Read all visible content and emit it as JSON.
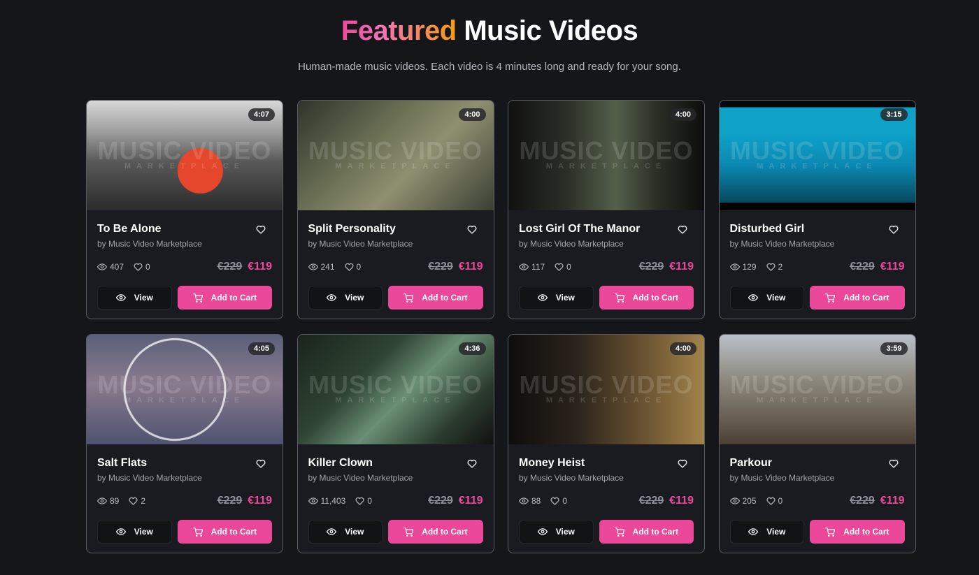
{
  "header": {
    "title_accent": "Featured",
    "title_rest": "Music Videos",
    "subtitle": "Human-made music videos. Each video is 4 minutes long and ready for your song."
  },
  "watermark": {
    "main": "MUSIC VIDEO",
    "sub": "MARKETPLACE"
  },
  "labels": {
    "view": "View",
    "add_to_cart": "Add to Cart"
  },
  "colors": {
    "background": "#15161a",
    "accent": "#ec4899",
    "card_border": "#5a5c66"
  },
  "icons": {
    "favorite": "heart-icon",
    "views": "eye-icon",
    "likes": "heart-icon",
    "view_button": "eye-icon",
    "cart_button": "cart-icon"
  },
  "videos": [
    {
      "title": "To Be Alone",
      "author": "by Music Video Marketplace",
      "duration": "4:07",
      "views": "407",
      "likes": "0",
      "old_price": "€229",
      "price": "€119"
    },
    {
      "title": "Split Personality",
      "author": "by Music Video Marketplace",
      "duration": "4:00",
      "views": "241",
      "likes": "0",
      "old_price": "€229",
      "price": "€119"
    },
    {
      "title": "Lost Girl Of The Manor",
      "author": "by Music Video Marketplace",
      "duration": "4:00",
      "views": "117",
      "likes": "0",
      "old_price": "€229",
      "price": "€119"
    },
    {
      "title": "Disturbed Girl",
      "author": "by Music Video Marketplace",
      "duration": "3:15",
      "views": "129",
      "likes": "2",
      "old_price": "€229",
      "price": "€119"
    },
    {
      "title": "Salt Flats",
      "author": "by Music Video Marketplace",
      "duration": "4:05",
      "views": "89",
      "likes": "2",
      "old_price": "€229",
      "price": "€119"
    },
    {
      "title": "Killer Clown",
      "author": "by Music Video Marketplace",
      "duration": "4:36",
      "views": "11,403",
      "likes": "0",
      "old_price": "€229",
      "price": "€119"
    },
    {
      "title": "Money Heist",
      "author": "by Music Video Marketplace",
      "duration": "4:00",
      "views": "88",
      "likes": "0",
      "old_price": "€229",
      "price": "€119"
    },
    {
      "title": "Parkour",
      "author": "by Music Video Marketplace",
      "duration": "3:59",
      "views": "205",
      "likes": "0",
      "old_price": "€229",
      "price": "€119"
    }
  ]
}
